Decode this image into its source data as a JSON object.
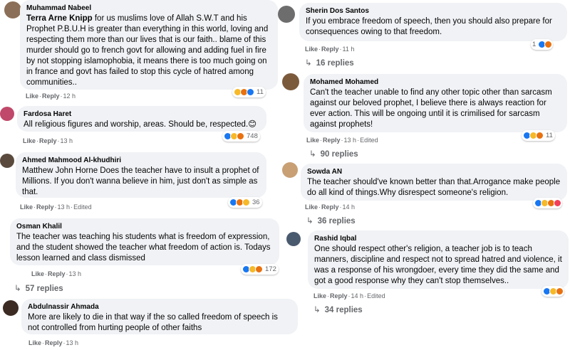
{
  "colors": {
    "bubble": "#f0f2f5",
    "like": "#1877f2",
    "meta": "#65676b"
  },
  "actions": {
    "like": "Like",
    "reply": "Reply",
    "edited": "Edited"
  },
  "left": [
    {
      "author": "Muhammad Nabeel",
      "mention": "Terra Arne Knipp",
      "text": "for us muslims love of Allah S.W.T and his Prophet P.B.U.H is greater than everything in this world, loving and respecting them more than our lives that is our faith.. blame of this murder should go to french govt for allowing and adding fuel in fire by not stopping islamophobia, it means there is too much going on in france and govt has failed to stop this cycle of hatred among communities..",
      "time": "12 h",
      "reaction_count": "11"
    },
    {
      "author": "Fardosa Haret",
      "text": "All religious figures and worship, areas. Should be, respected.😊",
      "time": "13 h",
      "reaction_count": "748"
    },
    {
      "author": "Ahmed Mahmood Al-khudhiri",
      "text": "Matthew John Horne Does the teacher have to insult a prophet of Millions. If you don't wanna believe in him, just don't as simple as that.",
      "time": "13 h",
      "reaction_count": "36"
    },
    {
      "author": "Osman Khalil",
      "text": "The teacher was teaching his students what is freedom of expression, and the student showed the teacher what freedom of action is. Todays lesson learned and class dismissed",
      "time": "13 h",
      "reaction_count": "172",
      "replies": "57 replies"
    },
    {
      "author": "Abdulnassir Ahmada",
      "text": "More are likely to die in that way if the so called freedom of speech is not controlled from hurting people of other faiths",
      "time": "13 h"
    }
  ],
  "right": [
    {
      "author": "Sherin Dos Santos",
      "text": "If you embrace freedom of speech, then you should also prepare for consequences owing to that freedom.",
      "time": "11 h",
      "reaction_count": "1",
      "replies": "16 replies"
    },
    {
      "author": "Mohamed Mohamed",
      "text": "Can't the teacher unable to find any other topic other than sarcasm against our beloved prophet, I believe there is always reaction for ever action. This will be ongoing until it is crimilised for sarcasm against prophets!",
      "time": "13 h",
      "reaction_count": "11",
      "replies": "90 replies"
    },
    {
      "author": "Sowda AN",
      "text": "The teacher should've known better than that.Arrogance make people do all kind of things.Why disrespect someone's religion.",
      "time": "14 h",
      "replies": "36 replies"
    },
    {
      "author": "Rashid Iqbal",
      "text": "One should respect other's religion, a teacher job is to teach manners, discipline and respect not to spread hatred and violence, it was a response of his wrongdoer, every time they did the same and got a good response why they can't stop themselves..",
      "time": "14 h",
      "replies": "34 replies"
    }
  ]
}
